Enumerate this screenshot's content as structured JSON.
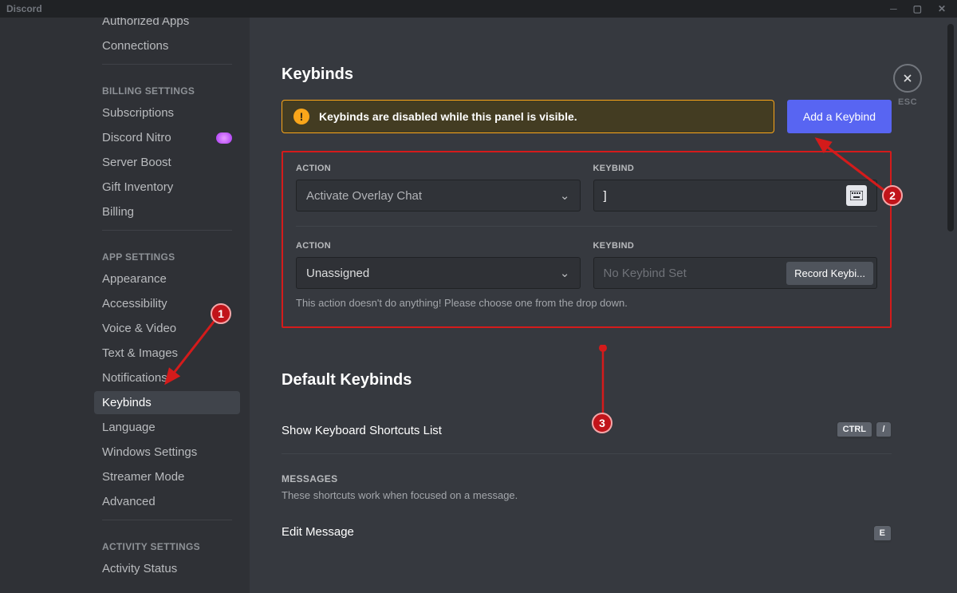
{
  "titlebar": {
    "title": "Discord"
  },
  "sidebar": {
    "sections": {
      "top_items": {
        "authorized_apps": "Authorized Apps",
        "connections": "Connections"
      },
      "billing": {
        "header": "BILLING SETTINGS",
        "subscriptions": "Subscriptions",
        "nitro": "Discord Nitro",
        "server_boost": "Server Boost",
        "gift_inventory": "Gift Inventory",
        "billing": "Billing"
      },
      "app": {
        "header": "APP SETTINGS",
        "appearance": "Appearance",
        "accessibility": "Accessibility",
        "voice_video": "Voice & Video",
        "text_images": "Text & Images",
        "notifications": "Notifications",
        "keybinds": "Keybinds",
        "language": "Language",
        "windows_settings": "Windows Settings",
        "streamer_mode": "Streamer Mode",
        "advanced": "Advanced"
      },
      "activity": {
        "header": "ACTIVITY SETTINGS",
        "activity_status": "Activity Status"
      }
    }
  },
  "page": {
    "title": "Keybinds",
    "warning": "Keybinds are disabled while this panel is visible.",
    "add_button": "Add a Keybind",
    "close_label": "ESC",
    "rows": {
      "row1": {
        "action_label": "ACTION",
        "action_value": "Activate Overlay Chat",
        "keybind_label": "KEYBIND",
        "keybind_value": "]"
      },
      "row2": {
        "action_label": "ACTION",
        "action_value": "Unassigned",
        "keybind_label": "KEYBIND",
        "keybind_placeholder": "No Keybind Set",
        "record_label": "Record Keybi..."
      },
      "hint": "This action doesn't do anything! Please choose one from the drop down."
    },
    "defaults": {
      "title": "Default Keybinds",
      "row1_label": "Show Keyboard Shortcuts List",
      "row1_key1": "CTRL",
      "row1_key2": "/",
      "messages_header": "MESSAGES",
      "messages_desc": "These shortcuts work when focused on a message.",
      "edit_label": "Edit Message",
      "edit_key": "E"
    }
  },
  "annotations": {
    "m1": "1",
    "m2": "2",
    "m3": "3"
  }
}
